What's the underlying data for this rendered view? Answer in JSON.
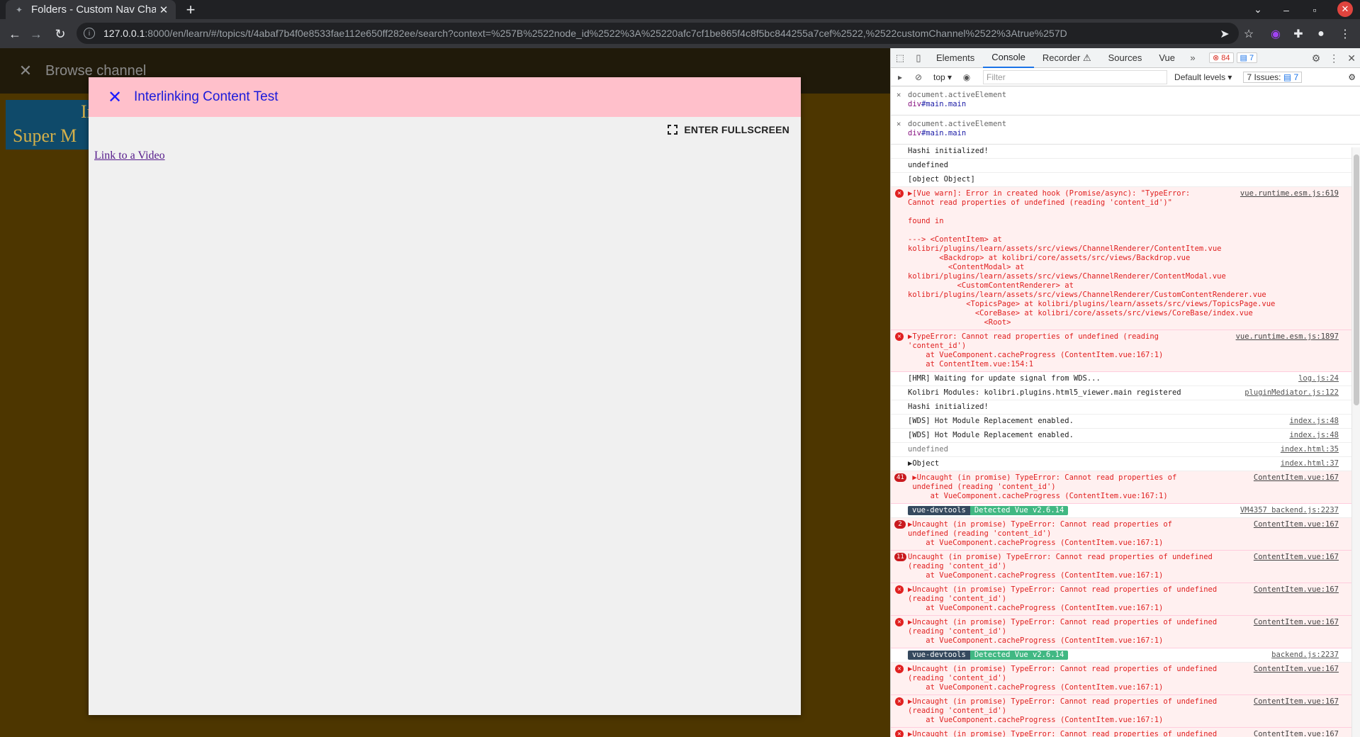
{
  "browser": {
    "tab_title": "Folders - Custom Nav Cha",
    "tab_close": "✕",
    "new_tab": "+",
    "url_host": "127.0.0.1",
    "url_path": ":8000/en/learn/#/topics/t/4abaf7b4f0e8533fae112e650ff282ee/search?context=%257B%2522node_id%2522%3A%25220afc7cf1be865f4c8f5bc844255a7cef%2522,%2522customChannel%2522%3Atrue%257D"
  },
  "app": {
    "appbar_title": "Browse channel",
    "behind_card_lines": [
      "In",
      "Super M"
    ]
  },
  "modal": {
    "title": "Interlinking Content Test",
    "fullscreen_label": "ENTER FULLSCREEN",
    "link_text": "Link to a Video"
  },
  "devtools": {
    "tabs": [
      "Elements",
      "Console",
      "Recorder ⚠",
      "Sources",
      "Vue"
    ],
    "error_count": "84",
    "issue_count": "7",
    "context": "top ▾",
    "filter_placeholder": "Filter",
    "levels": "Default levels ▾",
    "issues_label": "7 Issues:",
    "issues_num": "7",
    "live_expressions": [
      {
        "expr": "document.activeElement",
        "result_tag": "div",
        "result_id": "#main.main"
      },
      {
        "expr": "document.activeElement",
        "result_tag": "div",
        "result_id": "#main.main"
      }
    ],
    "messages": [
      {
        "type": "log",
        "text": "Hashi initialized!",
        "src": ""
      },
      {
        "type": "log",
        "text": "undefined",
        "src": ""
      },
      {
        "type": "log",
        "text": "[object Object]",
        "src": ""
      },
      {
        "type": "err",
        "text": "▶[Vue warn]: Error in created hook (Promise/async): \"TypeError:\nCannot read properties of undefined (reading 'content_id')\"\n\nfound in\n\n---> <ContentItem> at\nkolibri/plugins/learn/assets/src/views/ChannelRenderer/ContentItem.vue\n       <Backdrop> at kolibri/core/assets/src/views/Backdrop.vue\n         <ContentModal> at\nkolibri/plugins/learn/assets/src/views/ChannelRenderer/ContentModal.vue\n           <CustomContentRenderer> at\nkolibri/plugins/learn/assets/src/views/ChannelRenderer/CustomContentRenderer.vue\n             <TopicsPage> at kolibri/plugins/learn/assets/src/views/TopicsPage.vue\n               <CoreBase> at kolibri/core/assets/src/views/CoreBase/index.vue\n                 <Root>",
        "src": "vue.runtime.esm.js:619"
      },
      {
        "type": "err",
        "text": "▶TypeError: Cannot read properties of undefined (reading\n'content_id')\n    at VueComponent.cacheProgress (ContentItem.vue:167:1)\n    at ContentItem.vue:154:1",
        "src": "vue.runtime.esm.js:1897"
      },
      {
        "type": "log",
        "text": "[HMR] Waiting for update signal from WDS...",
        "src": "log.js:24"
      },
      {
        "type": "log",
        "text": "Kolibri Modules: kolibri.plugins.html5_viewer.main registered",
        "src": "pluginMediator.js:122"
      },
      {
        "type": "log",
        "text": "Hashi initialized!",
        "src": ""
      },
      {
        "type": "log",
        "text": "[WDS] Hot Module Replacement enabled.",
        "src": "index.js:48"
      },
      {
        "type": "log",
        "text": "[WDS] Hot Module Replacement enabled.",
        "src": "index.js:48"
      },
      {
        "type": "grey",
        "text": "undefined",
        "src": "index.html:35"
      },
      {
        "type": "log",
        "text": "▶Object",
        "src": "index.html:37"
      },
      {
        "type": "errc",
        "count": "41",
        "text": " ▶Uncaught (in promise) TypeError: Cannot read properties of\n undefined (reading 'content_id')\n     at VueComponent.cacheProgress (ContentItem.vue:167:1)",
        "src": "ContentItem.vue:167"
      },
      {
        "type": "vdt",
        "text": "vue-devtools",
        "text2": "Detected Vue v2.6.14",
        "src": "VM4357 backend.js:2237"
      },
      {
        "type": "errc",
        "count": "2",
        "text": "▶Uncaught (in promise) TypeError: Cannot read properties of\nundefined (reading 'content_id')\n    at VueComponent.cacheProgress (ContentItem.vue:167:1)",
        "src": "ContentItem.vue:167"
      },
      {
        "type": "errc",
        "count": "11",
        "text": "Uncaught (in promise) TypeError: Cannot read properties of undefined\n(reading 'content_id')\n    at VueComponent.cacheProgress (ContentItem.vue:167:1)",
        "src": "ContentItem.vue:167"
      },
      {
        "type": "err",
        "text": "▶Uncaught (in promise) TypeError: Cannot read properties of undefined\n(reading 'content_id')\n    at VueComponent.cacheProgress (ContentItem.vue:167:1)",
        "src": "ContentItem.vue:167"
      },
      {
        "type": "err",
        "text": "▶Uncaught (in promise) TypeError: Cannot read properties of undefined\n(reading 'content_id')\n    at VueComponent.cacheProgress (ContentItem.vue:167:1)",
        "src": "ContentItem.vue:167"
      },
      {
        "type": "vdt",
        "text": "vue-devtools",
        "text2": "Detected Vue v2.6.14",
        "src": "backend.js:2237"
      },
      {
        "type": "err",
        "text": "▶Uncaught (in promise) TypeError: Cannot read properties of undefined\n(reading 'content_id')\n    at VueComponent.cacheProgress (ContentItem.vue:167:1)",
        "src": "ContentItem.vue:167"
      },
      {
        "type": "err",
        "text": "▶Uncaught (in promise) TypeError: Cannot read properties of undefined\n(reading 'content_id')\n    at VueComponent.cacheProgress (ContentItem.vue:167:1)",
        "src": "ContentItem.vue:167"
      },
      {
        "type": "err",
        "text": "▶Uncaught (in promise) TypeError: Cannot read properties of undefined",
        "src": "ContentItem.vue:167"
      }
    ]
  },
  "colors": {
    "modal_header": "#ffc0cb",
    "page_bg": "#4d3600",
    "error_red": "#e02020",
    "vue_green": "#41b883"
  }
}
